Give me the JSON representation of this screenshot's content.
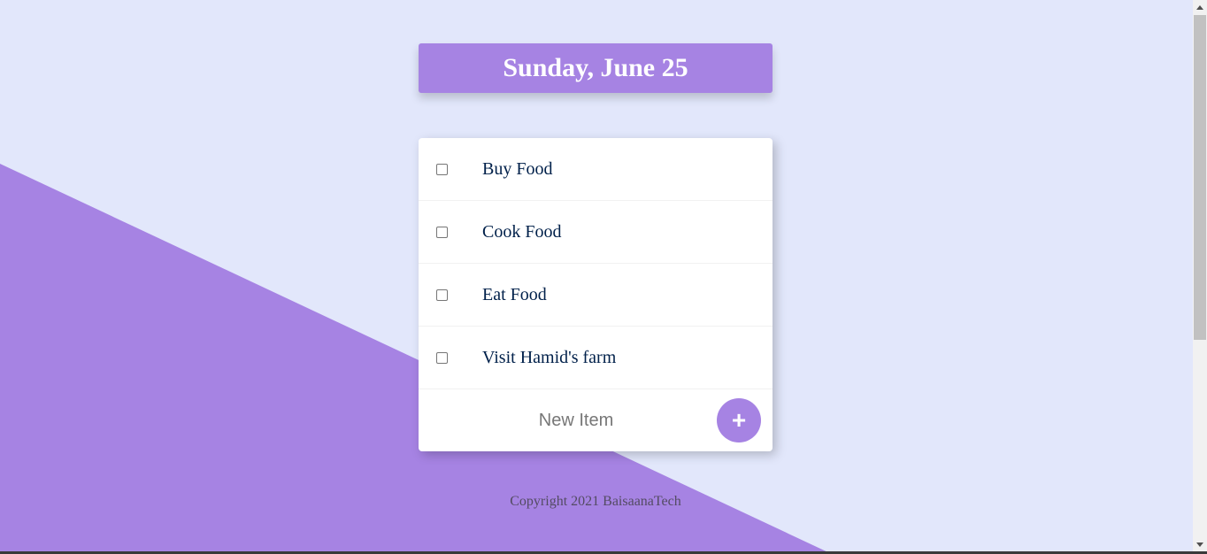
{
  "heading": {
    "day_label": "Sunday, June 25"
  },
  "todo": {
    "items": [
      {
        "label": "Buy Food",
        "checked": false
      },
      {
        "label": "Cook Food",
        "checked": false
      },
      {
        "label": "Eat Food",
        "checked": false
      },
      {
        "label": "Visit Hamid's farm",
        "checked": false
      }
    ],
    "new_item": {
      "placeholder": "New Item",
      "value": ""
    },
    "add_button_label": "+"
  },
  "footer": {
    "copyright": "Copyright 2021 BaisaanaTech"
  },
  "colors": {
    "background": "#e2e7fb",
    "accent": "#a683e3",
    "item_text": "#00204a"
  },
  "icons": {
    "scroll_up": "chevron-up-icon",
    "scroll_down": "chevron-down-icon"
  }
}
